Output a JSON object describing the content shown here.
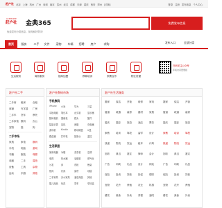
{
  "topbar": {
    "site": "赶户社",
    "cities": [
      "北京",
      "上海",
      "杭州",
      "广州",
      "深圳",
      "南京",
      "苏州",
      "武汉",
      "成都",
      "天津",
      "重庆",
      "西安",
      "郑州"
    ],
    "switch": "[切换]",
    "links": [
      "登录",
      "注册",
      "发布信息",
      "个人中心"
    ]
  },
  "header": {
    "logo": "赶户社",
    "logo_tag": "GANHUSHE",
    "city": "金典365",
    "slogan": "免费发布分类信息，找商家好帮手！",
    "search_placeholder": "",
    "post_button": "免费发布信息"
  },
  "nav": {
    "items": [
      "首页",
      "服务",
      "二手",
      "文件",
      "宠物",
      "车辆",
      "招聘",
      "房产",
      "求购"
    ],
    "right": [
      "发布入口",
      "全部分类"
    ]
  },
  "quick": {
    "items": [
      "生活服务",
      "商务服务",
      "招商加盟",
      "教育培训",
      "供需合作",
      "物业房屋"
    ],
    "qr_text": "扫码关注公众号",
    "qr_sub": "手机访问更便捷"
  },
  "panels": {
    "left": {
      "title": "赶户社二手",
      "rows": [
        [
          "二手房",
          "租房",
          "合租"
        ],
        [
          "商铺",
          "写字楼",
          "厂房"
        ],
        [
          "二手车",
          "货车",
          "摩托"
        ],
        [
          "二手家电",
          "数码",
          "办公"
        ],
        [
          "宠物",
          "猫",
          "狗"
        ]
      ],
      "sub": "二手市场",
      "rows2": [
        [
          "家具",
          "家电",
          "数码"
        ],
        [
          "手机",
          "电脑",
          "游戏"
        ],
        [
          "书籍",
          "服装",
          "母婴"
        ],
        [
          "收藏",
          "二手",
          "易拍"
        ],
        [
          "设备",
          "工具",
          "杂物"
        ],
        [
          "运动",
          "乐器",
          "其他"
        ]
      ]
    },
    "mid": {
      "title": "赶户社数码市场",
      "sub1": "手机数码",
      "rows1": [
        [
          "iPhone",
          "小米",
          "华为",
          "三星"
        ],
        [
          "平板电脑",
          "笔记本",
          "台式机",
          "显示器"
        ],
        [
          "数码相机",
          "摄像机",
          "镜头",
          "配件"
        ],
        [
          "智能手表",
          "耳机",
          "音箱",
          "充电器"
        ],
        [
          "游戏机",
          "Kindle",
          "移动硬盘",
          "U盘"
        ],
        [
          "路由器",
          "打印机",
          "投影仪",
          "监控"
        ]
      ],
      "sub2": "生活家居",
      "rows2": [
        [
          "家用电器",
          "冰箱",
          "洗衣机",
          "空调"
        ],
        [
          "电视",
          "热水器",
          "油烟机",
          "燃气灶"
        ],
        [
          "沙发",
          "床",
          "衣柜",
          "餐桌"
        ],
        [
          "厨具",
          "灯具",
          "窗帘",
          "地毯"
        ],
        [
          "二手家具",
          "办公家具",
          "酒店用品",
          "其他"
        ],
        [
          "婴儿用品",
          "玩具",
          "童车",
          "孕妇装"
        ]
      ]
    },
    "right": {
      "title": "赶户社生活服务",
      "rows": [
        [
          "搬家",
          "保洁",
          "开锁",
          "维修",
          "家电"
        ],
        [
          "管道",
          "疏通",
          "装修",
          "建材",
          "家具"
        ],
        [
          "婚庆",
          "摄影",
          "旅游",
          "酒店",
          "票务"
        ],
        [
          "家教",
          "培训",
          "驾校",
          "留学",
          "设计"
        ],
        [
          "快递",
          "物流",
          "货运",
          "租车",
          "代驾"
        ],
        [
          "回收",
          "典当",
          "鉴定",
          "律师",
          "会计"
        ],
        [
          "广告",
          "印刷",
          "礼品",
          "设计",
          "网站"
        ],
        [
          "保险",
          "投资",
          "贷款",
          "担保",
          "理财"
        ],
        [
          "宠物",
          "花卉",
          "养殖",
          "农业",
          "机械"
        ],
        [
          "餐饮",
          "美食",
          "外卖",
          "茶楼",
          "酒吧"
        ]
      ]
    }
  }
}
